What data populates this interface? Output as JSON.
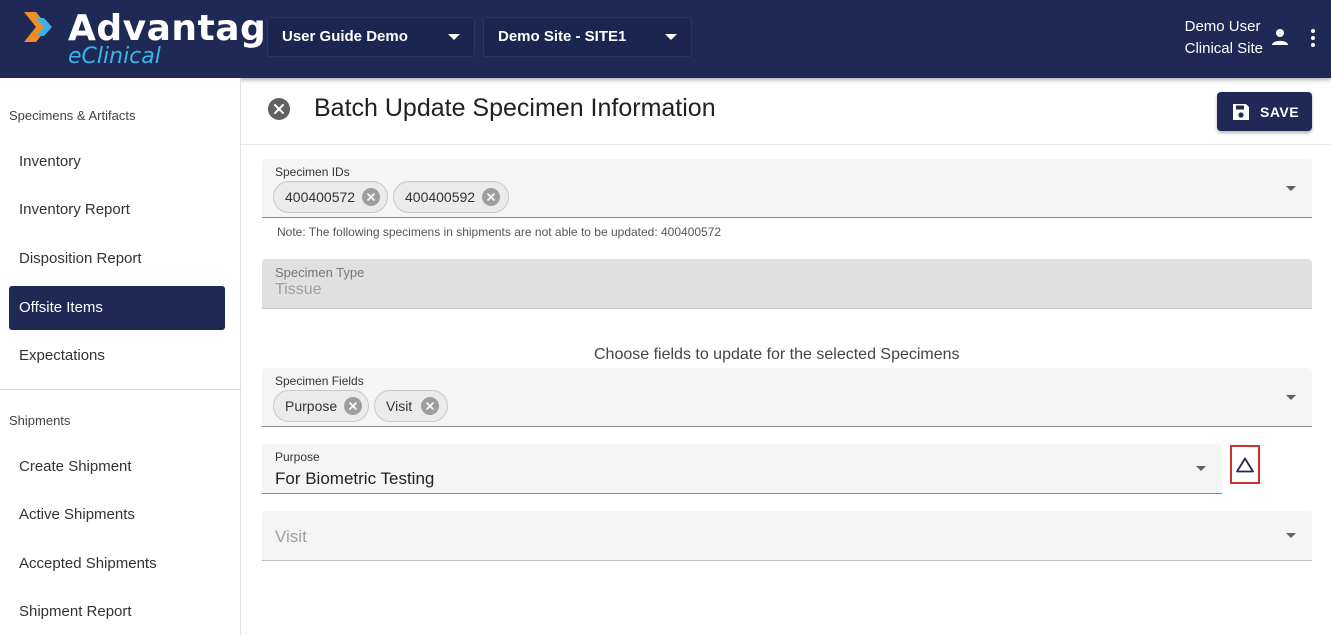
{
  "header": {
    "logo_title": "Advantage",
    "logo_subtitle": "eClinical",
    "study_selector": "User Guide Demo",
    "site_selector": "Demo Site - SITE1",
    "user_name": "Demo User",
    "user_role": "Clinical Site"
  },
  "sidebar": {
    "sections": [
      {
        "title": "Specimens & Artifacts",
        "items": [
          "Inventory",
          "Inventory Report",
          "Disposition Report",
          "Offsite Items",
          "Expectations"
        ]
      },
      {
        "title": "Shipments",
        "items": [
          "Create Shipment",
          "Active Shipments",
          "Accepted Shipments",
          "Shipment Report"
        ]
      }
    ],
    "active_item": "Offsite Items"
  },
  "page": {
    "title": "Batch Update Specimen Information",
    "save_label": "SAVE"
  },
  "form": {
    "specimen_ids": {
      "label": "Specimen IDs",
      "chips": [
        "400400572",
        "400400592"
      ]
    },
    "note": "Note: The following specimens in shipments are not able to be updated: 400400572",
    "specimen_type": {
      "label": "Specimen Type",
      "value": "Tissue"
    },
    "choose_text": "Choose fields to update for the selected Specimens",
    "specimen_fields": {
      "label": "Specimen Fields",
      "chips": [
        "Purpose",
        "Visit"
      ]
    },
    "purpose": {
      "label": "Purpose",
      "value": "For Biometric Testing"
    },
    "visit": {
      "placeholder": "Visit"
    }
  },
  "colors": {
    "header_bg": "#1e2a55",
    "accent_blue": "#3bb3e8",
    "logo_orange": "#f28c28",
    "warning_border": "#d32f2f"
  },
  "icons": {
    "close": "close-circle-icon",
    "save": "floppy-disk-icon",
    "user": "person-icon",
    "menu": "kebab-menu-icon",
    "warning": "warning-triangle-icon"
  }
}
